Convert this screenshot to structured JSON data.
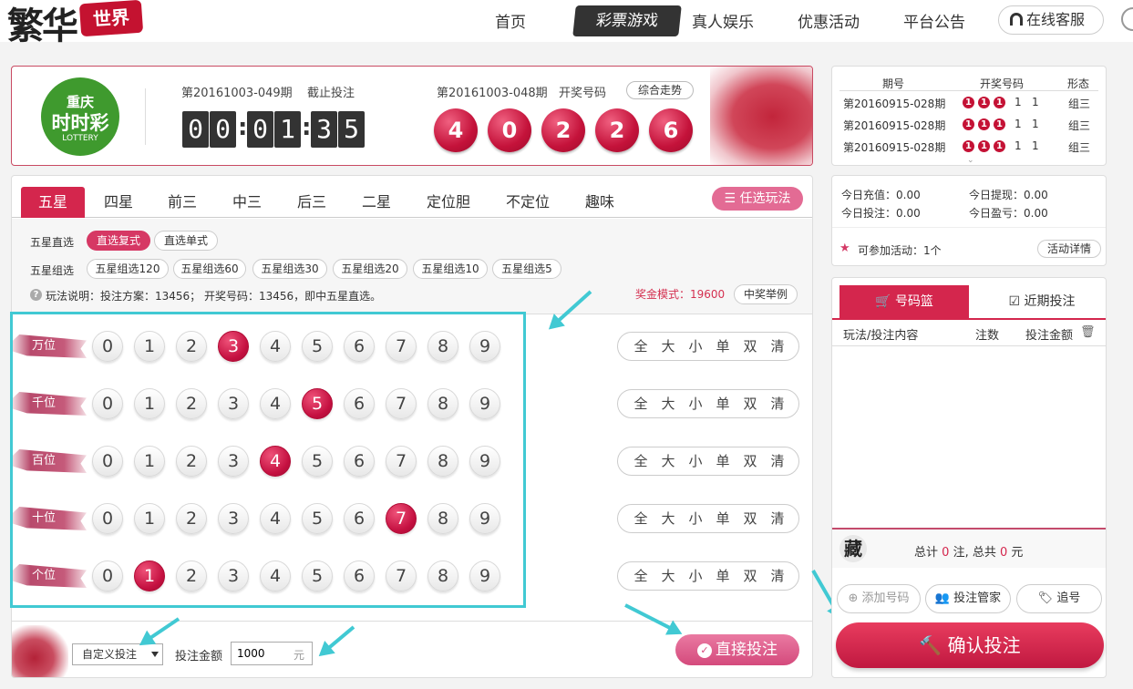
{
  "brand": {
    "logo_text": "繁华",
    "badge_text": "世界"
  },
  "nav": {
    "items": [
      "首页",
      "彩票游戏",
      "真人娱乐",
      "优惠活动",
      "平台公告"
    ],
    "active": "彩票游戏",
    "service": "在线客服"
  },
  "lottery": {
    "logo_line1": "重庆",
    "logo_line2": "时时彩",
    "logo_line3": "LOTTERY",
    "current_issue": "第20161003-049期",
    "current_status": "截止投注",
    "countdown": [
      "0",
      "0",
      "0",
      "1",
      "3",
      "5"
    ],
    "last_issue": "第20161003-048期",
    "last_label": "开奖号码",
    "trend_button": "综合走势",
    "winning_numbers": [
      "4",
      "0",
      "2",
      "2",
      "6"
    ]
  },
  "play_tabs": [
    "五星",
    "四星",
    "前三",
    "中三",
    "后三",
    "二星",
    "定位胆",
    "不定位",
    "趣味"
  ],
  "free_play_button": "任选玩法",
  "sub_modes": {
    "row1_label": "五星直选",
    "row1_options": [
      "直选复式",
      "直选单式"
    ],
    "row1_selected": "直选复式",
    "row2_label": "五星组选",
    "row2_options": [
      "五星组选120",
      "五星组选60",
      "五星组选30",
      "五星组选20",
      "五星组选10",
      "五星组选5"
    ],
    "rule_text": "玩法说明：投注方案：13456； 开奖号码：13456，即中五星直选。",
    "prize_mode": "奖金模式：19600",
    "example_button": "中奖举例"
  },
  "positions": [
    {
      "label": "万位",
      "selected": 3
    },
    {
      "label": "千位",
      "selected": 5
    },
    {
      "label": "百位",
      "selected": 4
    },
    {
      "label": "十位",
      "selected": 7
    },
    {
      "label": "个位",
      "selected": 1
    }
  ],
  "digits": [
    "0",
    "1",
    "2",
    "3",
    "4",
    "5",
    "6",
    "7",
    "8",
    "9"
  ],
  "quick_pick": [
    "全",
    "大",
    "小",
    "单",
    "双",
    "清"
  ],
  "bet_bar": {
    "mode_select": "自定义投注",
    "amount_label": "投注金额",
    "amount_value": "1000",
    "amount_unit": "元",
    "direct_bet": "直接投注"
  },
  "history": {
    "headers": [
      "期号",
      "开奖号码",
      "形态"
    ],
    "rows": [
      {
        "issue": "第20160915-028期",
        "balls": [
          "1",
          "1",
          "1"
        ],
        "rest": [
          "1",
          "1"
        ],
        "shape": "组三"
      },
      {
        "issue": "第20160915-028期",
        "balls": [
          "1",
          "1",
          "1"
        ],
        "rest": [
          "1",
          "1"
        ],
        "shape": "组三"
      },
      {
        "issue": "第20160915-028期",
        "balls": [
          "1",
          "1",
          "1"
        ],
        "rest": [
          "1",
          "1"
        ],
        "shape": "组三"
      }
    ]
  },
  "account": {
    "recharge": "今日充值：0.00",
    "withdraw": "今日提现：0.00",
    "bet": "今日投注：0.00",
    "profit": "今日盈亏：0.00",
    "activities": "可参加活动：1个",
    "activity_button": "活动详情"
  },
  "basket": {
    "tab_basket": "号码篮",
    "tab_recent": "近期投注",
    "col_content": "玩法/投注内容",
    "col_count": "注数",
    "col_amount": "投注金额",
    "seal": "藏",
    "total_prefix": "总计",
    "total_bets": "0",
    "total_mid": "注, 总共",
    "total_amount": "0",
    "total_suffix": "元",
    "add_button": "添加号码",
    "manage_button": "投注管家",
    "chase_button": "追号",
    "confirm_button": "确认投注"
  },
  "colors": {
    "accent": "#d4264d",
    "annotation": "#41c9d3",
    "lottery_green": "#3f9a2e"
  }
}
